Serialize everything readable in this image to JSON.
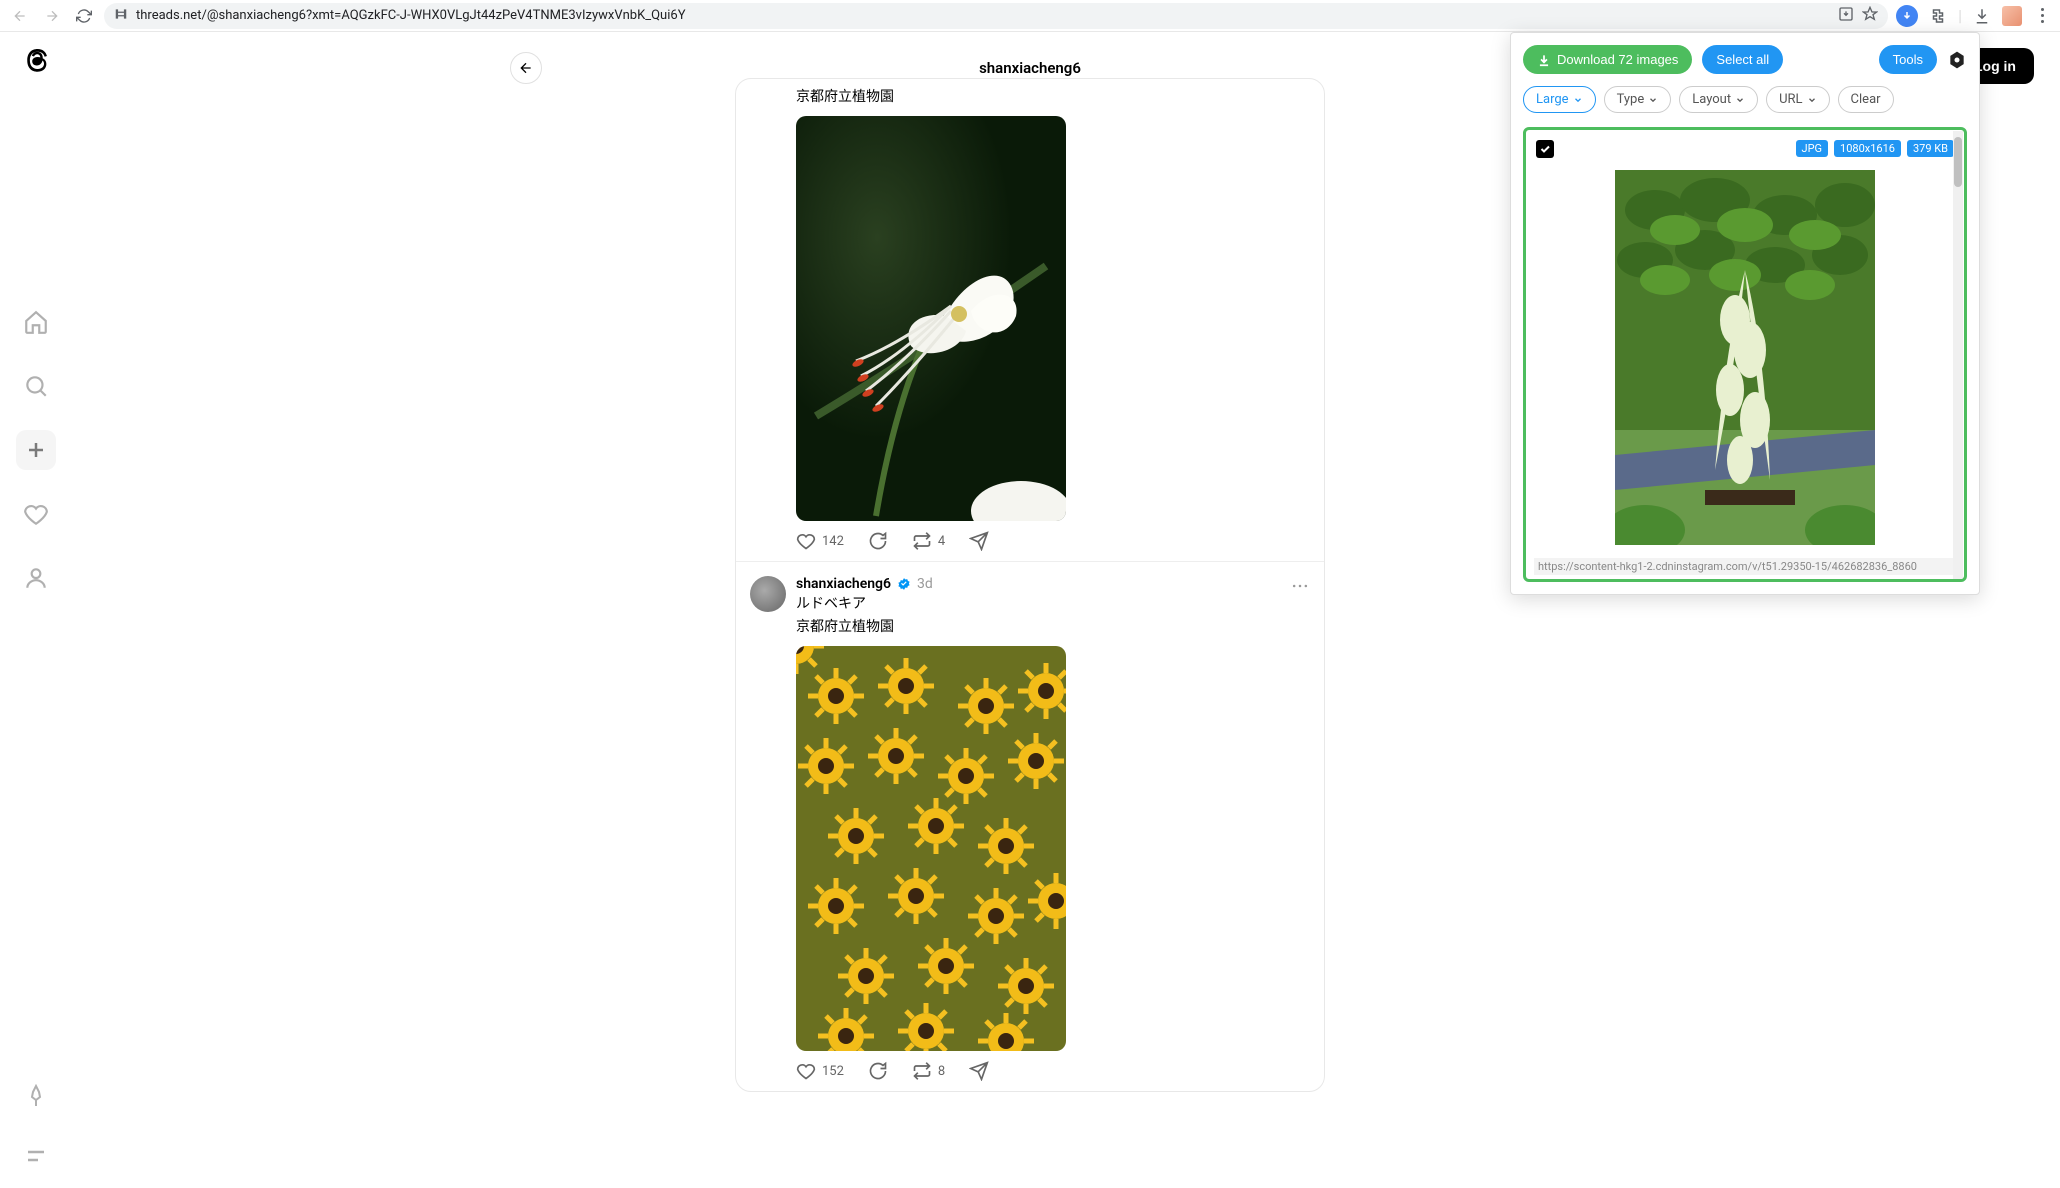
{
  "browser": {
    "url": "threads.net/@shanxiacheng6?xmt=AQGzkFC-J-WHX0VLgJt44zPeV4TNME3vIzywxVnbK_Qui6Y"
  },
  "header": {
    "username": "shanxiacheng6",
    "login": "Log in"
  },
  "posts": [
    {
      "location": "京都府立植物園",
      "likes": "142",
      "reposts": "4"
    },
    {
      "user": "shanxiacheng6",
      "time": "3d",
      "caption": "ルドベキア",
      "location": "京都府立植物園",
      "likes": "152",
      "reposts": "8"
    }
  ],
  "ext": {
    "download": "Download 72 images",
    "selectall": "Select all",
    "tools": "Tools",
    "filters": {
      "large": "Large",
      "type": "Type",
      "layout": "Layout",
      "url": "URL",
      "clear": "Clear"
    },
    "badges": {
      "format": "JPG",
      "dims": "1080x1616",
      "size": "379 KB"
    },
    "item_url": "https://scontent-hkg1-2.cdninstagram.com/v/t51.29350-15/462682836_8860"
  }
}
